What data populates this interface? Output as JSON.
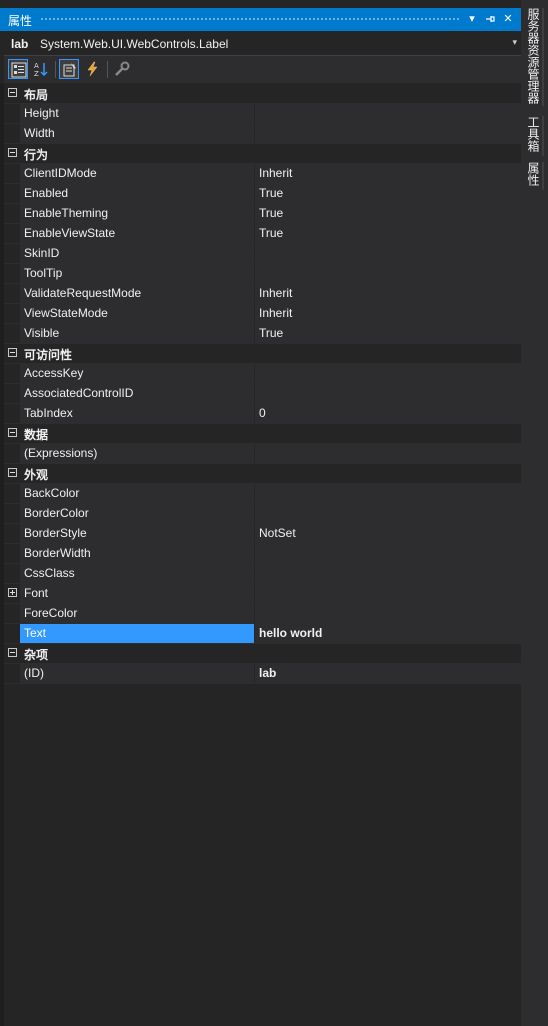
{
  "window": {
    "title": "属性",
    "pin_label": "▾",
    "autohide_label": "⊣",
    "close_label": "✕"
  },
  "object": {
    "name": "lab",
    "type": "System.Web.UI.WebControls.Label",
    "dropdown_arrow": "▾"
  },
  "toolbar": {
    "buttons": [
      {
        "icon": "categorized-icon",
        "active": true
      },
      {
        "icon": "alphabetical-icon",
        "active": false
      },
      {
        "icon": "properties-icon",
        "active": true
      },
      {
        "icon": "events-icon",
        "active": false
      },
      {
        "icon": "property-pages-icon",
        "active": false
      }
    ]
  },
  "grid": {
    "rows": [
      {
        "kind": "category",
        "label": "布局"
      },
      {
        "kind": "prop",
        "name": "Height",
        "value": ""
      },
      {
        "kind": "prop",
        "name": "Width",
        "value": ""
      },
      {
        "kind": "category",
        "label": "行为"
      },
      {
        "kind": "prop",
        "name": "ClientIDMode",
        "value": "Inherit"
      },
      {
        "kind": "prop",
        "name": "Enabled",
        "value": "True"
      },
      {
        "kind": "prop",
        "name": "EnableTheming",
        "value": "True"
      },
      {
        "kind": "prop",
        "name": "EnableViewState",
        "value": "True"
      },
      {
        "kind": "prop",
        "name": "SkinID",
        "value": ""
      },
      {
        "kind": "prop",
        "name": "ToolTip",
        "value": ""
      },
      {
        "kind": "prop",
        "name": "ValidateRequestMode",
        "value": "Inherit"
      },
      {
        "kind": "prop",
        "name": "ViewStateMode",
        "value": "Inherit"
      },
      {
        "kind": "prop",
        "name": "Visible",
        "value": "True"
      },
      {
        "kind": "category",
        "label": "可访问性"
      },
      {
        "kind": "prop",
        "name": "AccessKey",
        "value": ""
      },
      {
        "kind": "prop",
        "name": "AssociatedControlID",
        "value": ""
      },
      {
        "kind": "prop",
        "name": "TabIndex",
        "value": "0"
      },
      {
        "kind": "category",
        "label": "数据"
      },
      {
        "kind": "prop",
        "name": "(Expressions)",
        "value": ""
      },
      {
        "kind": "category",
        "label": "外观"
      },
      {
        "kind": "prop",
        "name": "BackColor",
        "value": ""
      },
      {
        "kind": "prop",
        "name": "BorderColor",
        "value": ""
      },
      {
        "kind": "prop",
        "name": "BorderStyle",
        "value": "NotSet"
      },
      {
        "kind": "prop",
        "name": "BorderWidth",
        "value": ""
      },
      {
        "kind": "prop",
        "name": "CssClass",
        "value": ""
      },
      {
        "kind": "prop",
        "name": "Font",
        "value": "",
        "expandable": true
      },
      {
        "kind": "prop",
        "name": "ForeColor",
        "value": ""
      },
      {
        "kind": "prop",
        "name": "Text",
        "value": "hello world",
        "bold": true,
        "selected": true
      },
      {
        "kind": "category",
        "label": "杂项"
      },
      {
        "kind": "prop",
        "name": "(ID)",
        "value": "lab",
        "bold": true
      }
    ]
  },
  "side_tabs": [
    "服务器资源管理器",
    "工具箱",
    "属性"
  ],
  "colors": {
    "accent": "#007acc",
    "selection": "#3399ff",
    "panel": "#252526",
    "row": "#2d2d30"
  }
}
